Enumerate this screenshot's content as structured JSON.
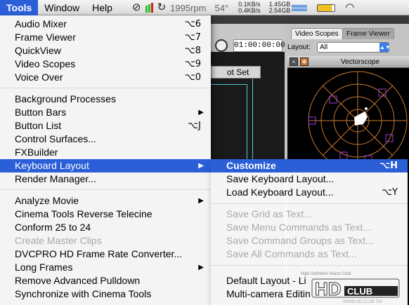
{
  "menubar": {
    "items": [
      {
        "label": "Tools",
        "active": true
      },
      {
        "label": "Window",
        "active": false
      },
      {
        "label": "Help",
        "active": false
      }
    ],
    "fan_speed": "1995rpm",
    "temperature": "54°",
    "net_up": "0.1KB/s",
    "net_down": "0.4KB/s",
    "disk_read": "1.45GB",
    "disk_write": "2.54GB"
  },
  "background": {
    "timecode": "01:00:00:00",
    "preset_text": "ot Set",
    "tabs": [
      "Video Scopes",
      "Frame Viewer"
    ],
    "layout_label": "Layout:",
    "layout_value": "All",
    "scope_title": "Vectorscope"
  },
  "menu": {
    "items": [
      {
        "label": "Audio Mixer",
        "shortcut": "⌥6"
      },
      {
        "label": "Frame Viewer",
        "shortcut": "⌥7"
      },
      {
        "label": "QuickView",
        "shortcut": "⌥8"
      },
      {
        "label": "Video Scopes",
        "shortcut": "⌥9"
      },
      {
        "label": "Voice Over",
        "shortcut": "⌥0"
      },
      {
        "label": "Background Processes",
        "shortcut": ""
      },
      {
        "label": "Button Bars",
        "shortcut": "",
        "submenu": true
      },
      {
        "label": "Button List",
        "shortcut": "⌥J"
      },
      {
        "label": "Control Surfaces...",
        "shortcut": ""
      },
      {
        "label": "FXBuilder",
        "shortcut": ""
      },
      {
        "label": "Keyboard Layout",
        "shortcut": "",
        "submenu": true,
        "active": true
      },
      {
        "label": "Render Manager...",
        "shortcut": ""
      },
      {
        "label": "Analyze Movie",
        "shortcut": "",
        "submenu": true
      },
      {
        "label": "Cinema Tools Reverse Telecine",
        "shortcut": ""
      },
      {
        "label": "Conform 25 to 24",
        "shortcut": ""
      },
      {
        "label": "Create Master Clips",
        "shortcut": "",
        "disabled": true
      },
      {
        "label": "DVCPRO HD Frame Rate Converter...",
        "shortcut": ""
      },
      {
        "label": "Long Frames",
        "shortcut": "",
        "submenu": true
      },
      {
        "label": "Remove Advanced Pulldown",
        "shortcut": ""
      },
      {
        "label": "Synchronize with Cinema Tools",
        "shortcut": ""
      }
    ]
  },
  "submenu": {
    "items": [
      {
        "label": "Customize",
        "shortcut": "⌥H",
        "active": true
      },
      {
        "label": "Save Keyboard Layout...",
        "shortcut": ""
      },
      {
        "label": "Load Keyboard Layout...",
        "shortcut": "⌥Y"
      },
      {
        "label": "Save Grid as Text...",
        "shortcut": "",
        "disabled": true
      },
      {
        "label": "Save Menu Commands as Text...",
        "shortcut": "",
        "disabled": true
      },
      {
        "label": "Save Command Groups as Text...",
        "shortcut": "",
        "disabled": true
      },
      {
        "label": "Save All Commands as Text...",
        "shortcut": "",
        "disabled": true
      },
      {
        "label": "Default Layout - Li",
        "shortcut": ""
      },
      {
        "label": "Multi-camera Editin",
        "shortcut": ""
      }
    ]
  },
  "watermark": {
    "tagline": "High Definition Vision Club",
    "brand_hd": "HD",
    "brand_club": "CLUB",
    "url": "WWW.HD.CLUB.TW"
  },
  "colors": {
    "highlight": "#2a5fd8",
    "scope_ring": "#c87830",
    "scope_target": "#9a3fd0"
  }
}
